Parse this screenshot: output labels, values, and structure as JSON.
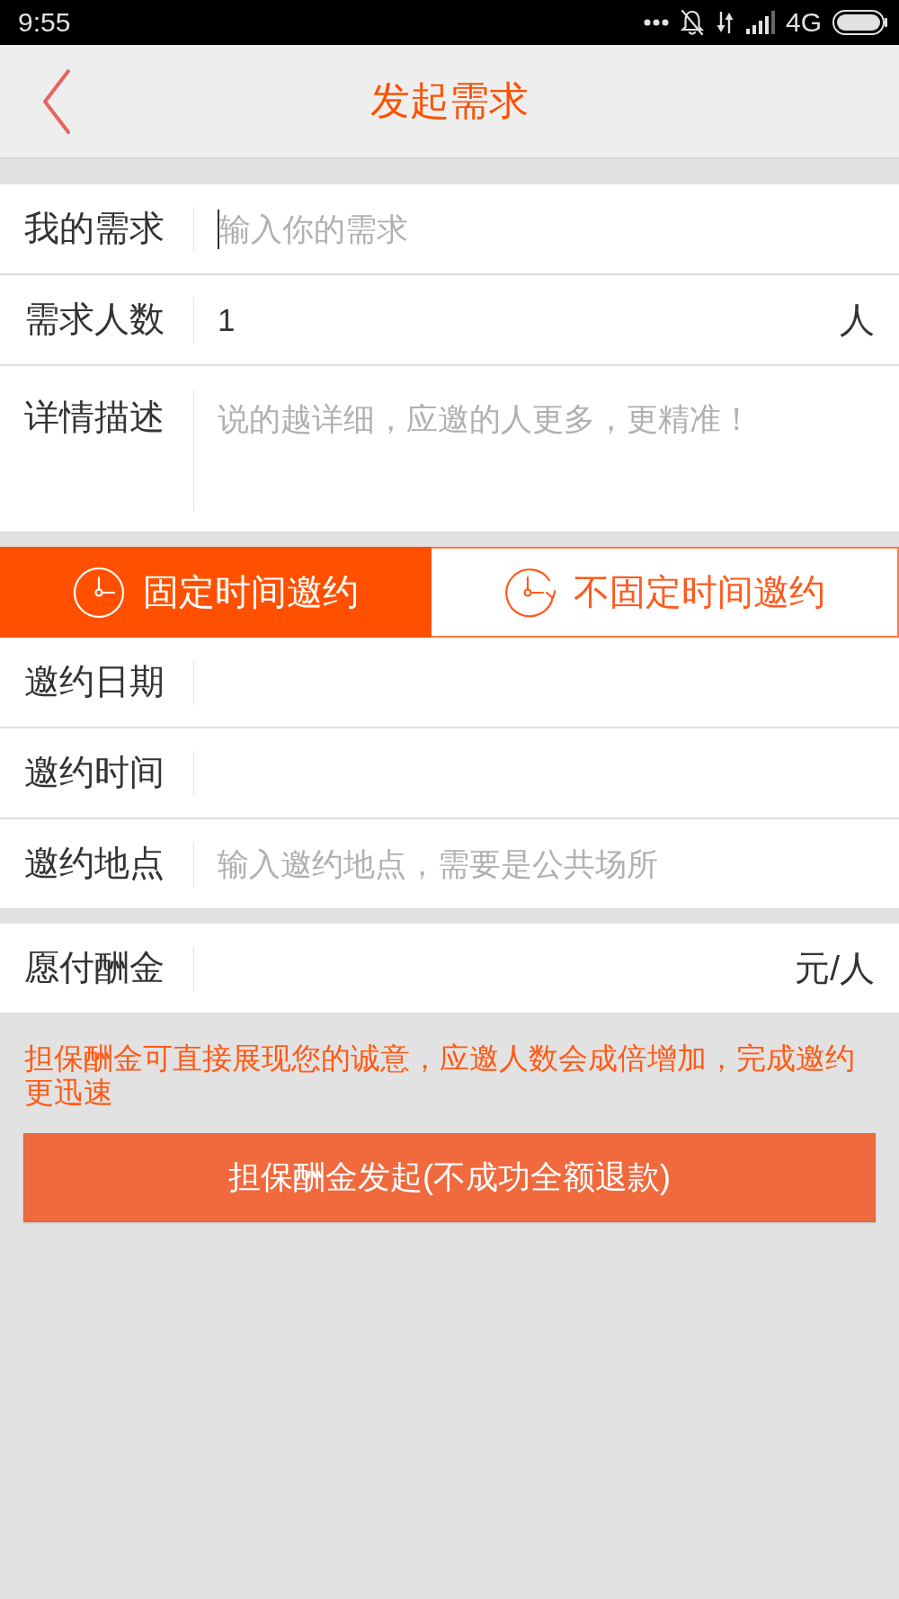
{
  "status_bar": {
    "time": "9:55",
    "network": "4G"
  },
  "header": {
    "title": "发起需求"
  },
  "form_fields": [
    {
      "kind": "input",
      "label": "我的需求",
      "placeholder": "输入你的需求",
      "focused": true
    },
    {
      "kind": "input",
      "label": "需求人数",
      "value": "1",
      "unit": "人",
      "focused": false
    },
    {
      "kind": "textarea",
      "label": "详情描述",
      "placeholder": "说的越详细，应邀的人更多，更精准！",
      "focused": false
    }
  ],
  "time_tabs": [
    {
      "kind": "fixed",
      "label": "固定时间邀约",
      "selected": true
    },
    {
      "kind": "flexible",
      "label": "不固定时间邀约",
      "selected": false
    }
  ],
  "invite_fields": [
    {
      "kind": "input",
      "label": "邀约日期"
    },
    {
      "kind": "input",
      "label": "邀约时间"
    },
    {
      "kind": "input",
      "label": "邀约地点",
      "placeholder": "输入邀约地点，需要是公共场所"
    }
  ],
  "reward_fields": [
    {
      "kind": "input",
      "label": "愿付酬金",
      "unit": "元/人"
    }
  ],
  "note": "担保酬金可直接展现您的诚意，应邀人数会成倍增加，完成邀约更迅速",
  "submit_button": "担保酬金发起(不成功全额退款)"
}
